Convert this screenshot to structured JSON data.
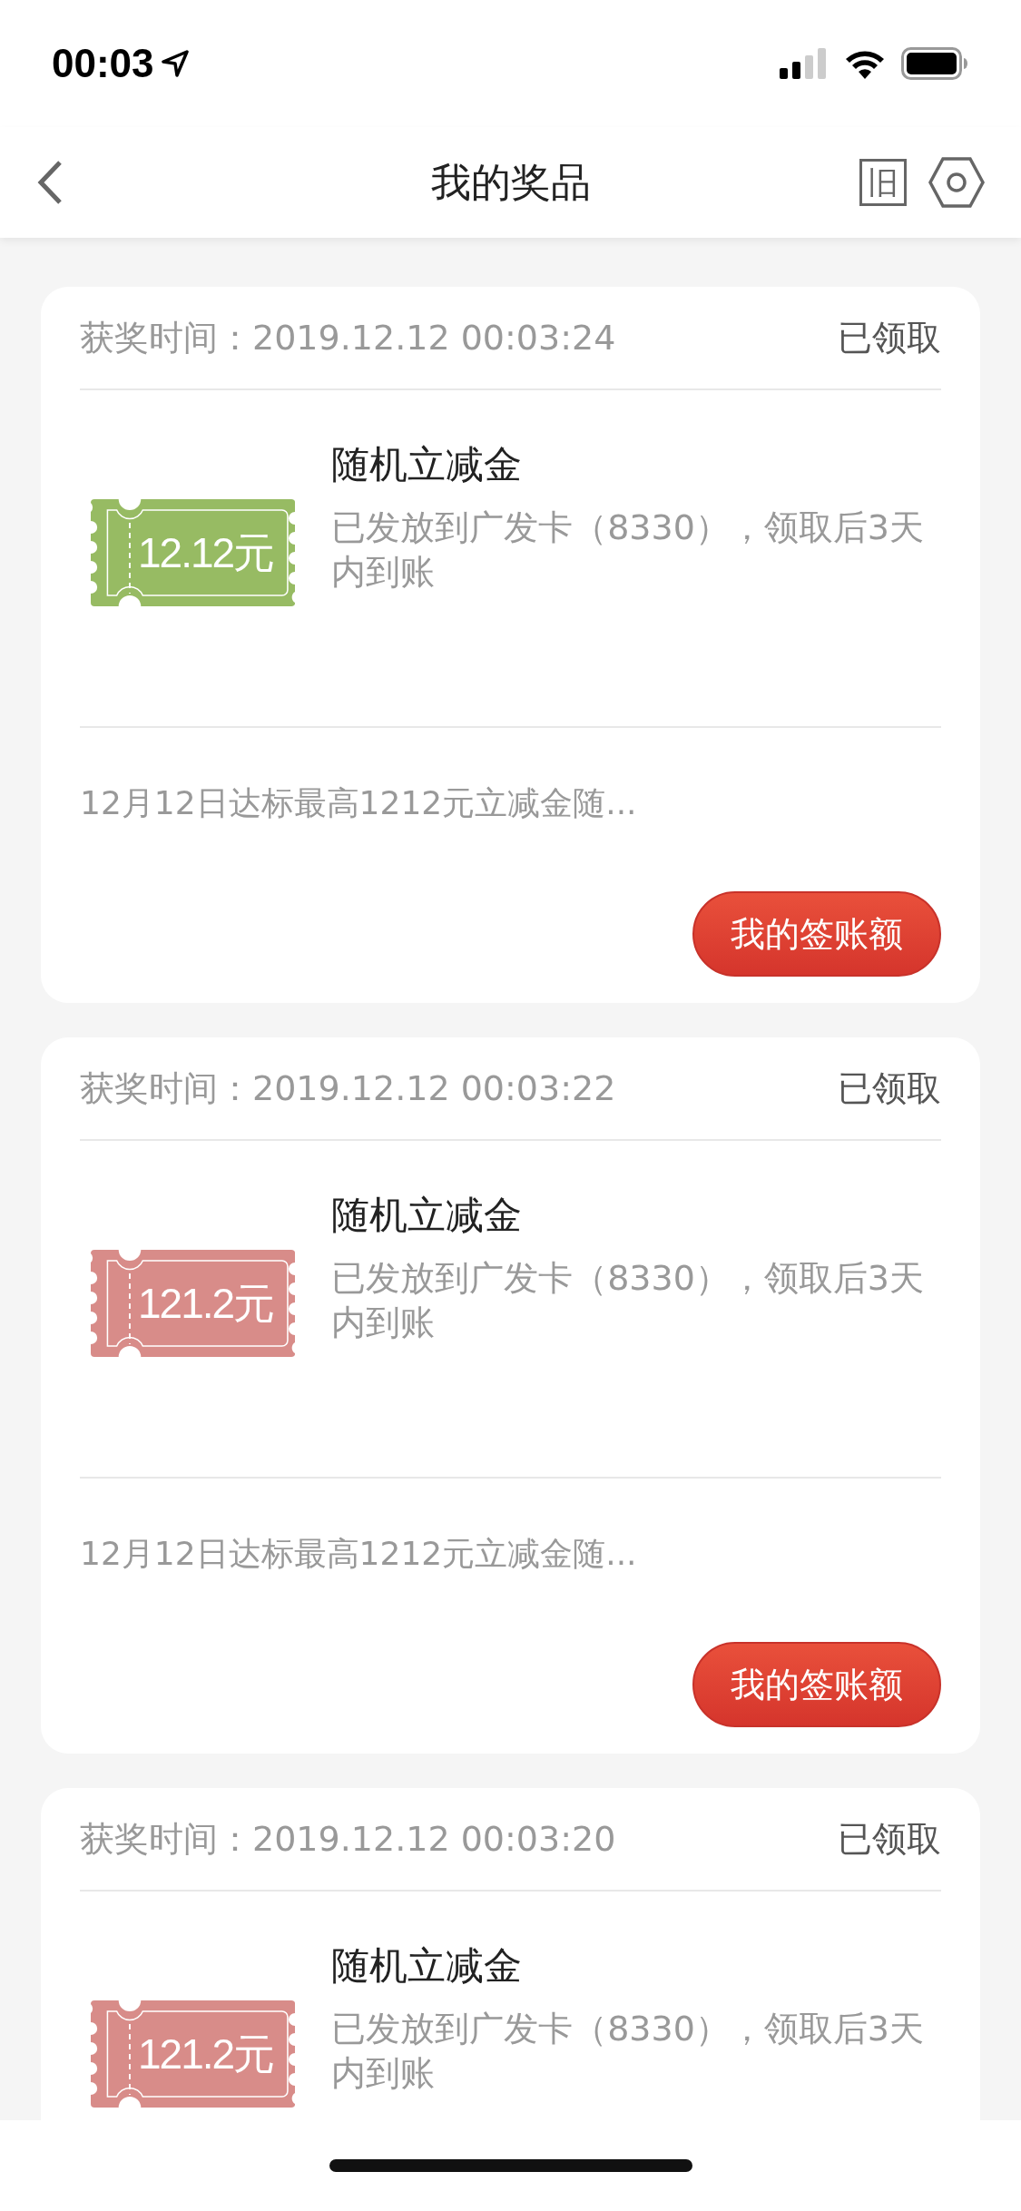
{
  "status_bar": {
    "time": "00:03"
  },
  "nav": {
    "title": "我的奖品",
    "old_button": "旧"
  },
  "prizes": [
    {
      "time_label": "获奖时间：2019.12.12 00:03:24",
      "status": "已领取",
      "amount": "12.12元",
      "color": "#97bb63",
      "title": "随机立减金",
      "description": "已发放到广发卡（8330），领取后3天内到账",
      "activity": "12月12日达标最高1212元立减金随...",
      "button": "我的签账额"
    },
    {
      "time_label": "获奖时间：2019.12.12 00:03:22",
      "status": "已领取",
      "amount": "121.2元",
      "color": "#d88c89",
      "title": "随机立减金",
      "description": "已发放到广发卡（8330），领取后3天内到账",
      "activity": "12月12日达标最高1212元立减金随...",
      "button": "我的签账额"
    },
    {
      "time_label": "获奖时间：2019.12.12 00:03:20",
      "status": "已领取",
      "amount": "121.2元",
      "color": "#d88c89",
      "title": "随机立减金",
      "description": "已发放到广发卡（8330），领取后3天内到账"
    }
  ]
}
